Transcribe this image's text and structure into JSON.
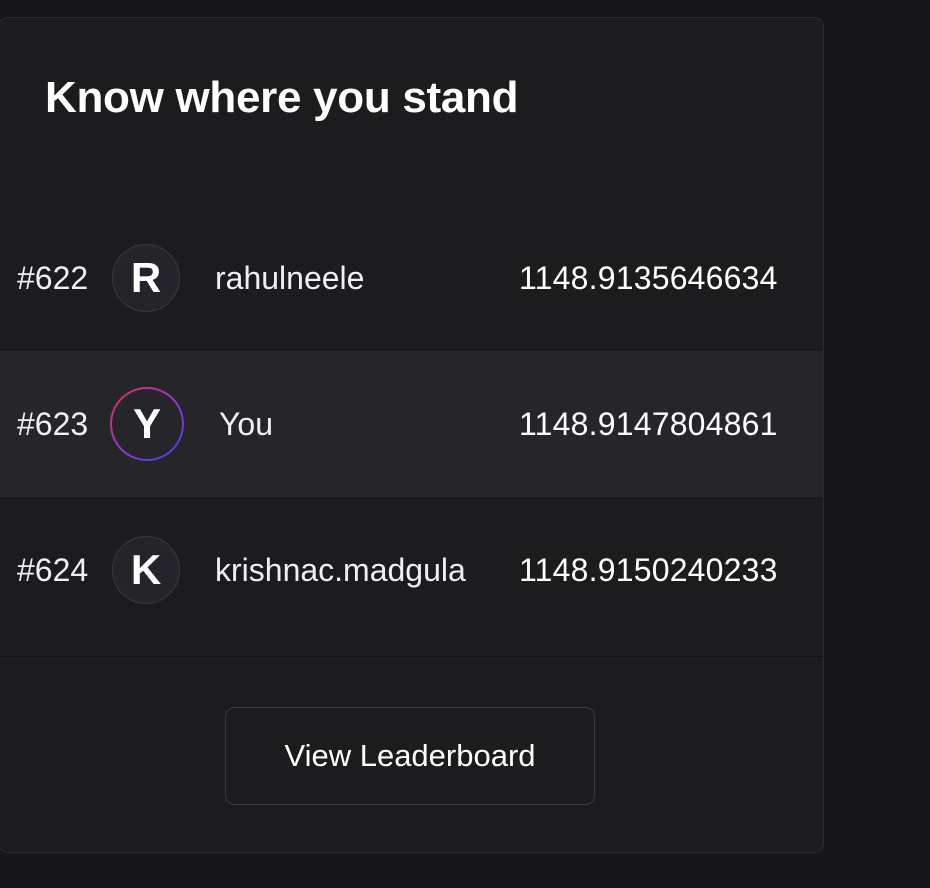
{
  "card": {
    "title": "Know where you stand",
    "rows": [
      {
        "rank": "#622",
        "initial": "R",
        "name": "rahulneele",
        "score": "1148.9135646634",
        "is_you": false
      },
      {
        "rank": "#623",
        "initial": "Y",
        "name": "You",
        "score": "1148.9147804861",
        "is_you": true
      },
      {
        "rank": "#624",
        "initial": "K",
        "name": "krishnac.madgula",
        "score": "1148.9150240233",
        "is_you": false
      }
    ],
    "button_label": "View Leaderboard"
  },
  "colors": {
    "page_bg": "#161517",
    "card_bg": "#1c1b1e",
    "highlight_row_bg": "#262529",
    "you_ring_gradient": [
      "#e0344a",
      "#9b35d6",
      "#3646e0"
    ]
  }
}
